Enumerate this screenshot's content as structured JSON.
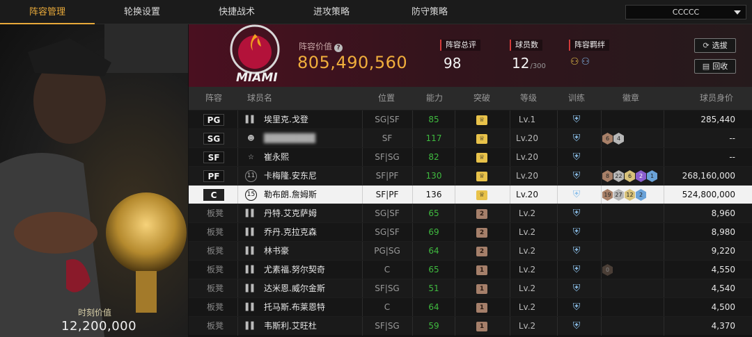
{
  "nav": {
    "tabs": [
      "阵容管理",
      "轮换设置",
      "快捷战术",
      "进攻策略",
      "防守策略"
    ],
    "active_index": 0,
    "team_select": "CCCCC"
  },
  "portrait": {
    "label": "时刻价值",
    "value": "12,200,000"
  },
  "summary": {
    "logo_text": "MIAMI",
    "value_label": "阵容价值",
    "value": "805,490,560",
    "overall_label": "阵容总评",
    "overall_value": "98",
    "count_label": "球员数",
    "count_value": "12",
    "count_max": "/300",
    "bond_label": "阵容羁绊",
    "select_button": "选拔",
    "recycle_button": "回收"
  },
  "table": {
    "headers": [
      "阵容",
      "球员名",
      "位置",
      "能力",
      "突破",
      "等级",
      "训练",
      "徽章",
      "球员身价"
    ],
    "rows": [
      {
        "slot": "PG",
        "starter": true,
        "icon": "bars",
        "name": "埃里克.戈登",
        "pos": "SG|SF",
        "ability": "85",
        "break": "crown",
        "level": "Lv.1",
        "badges": [],
        "salary": "285,440"
      },
      {
        "slot": "SG",
        "starter": true,
        "icon": "person",
        "name": "████████",
        "blur": true,
        "pos": "SF",
        "ability": "117",
        "break": "crown",
        "level": "Lv.20",
        "badges": [
          {
            "t": "6",
            "c": "bronze"
          },
          {
            "t": "4",
            "c": "silver"
          }
        ],
        "salary": "--"
      },
      {
        "slot": "SF",
        "starter": true,
        "icon": "star",
        "name": "崔永熙",
        "pos": "SF|SG",
        "ability": "82",
        "break": "crown",
        "level": "Lv.20",
        "badges": [],
        "salary": "--"
      },
      {
        "slot": "PF",
        "starter": true,
        "icon": "num",
        "icon_text": "11",
        "name": "卡梅隆.安东尼",
        "pos": "SF|PF",
        "ability": "130",
        "break": "crown",
        "level": "Lv.20",
        "badges": [
          {
            "t": "8",
            "c": "bronze"
          },
          {
            "t": "22",
            "c": "silver"
          },
          {
            "t": "6",
            "c": "gold"
          },
          {
            "t": "2",
            "c": "purple"
          },
          {
            "t": "1",
            "c": "blue"
          }
        ],
        "salary": "268,160,000"
      },
      {
        "slot": "C",
        "starter": true,
        "highlight": true,
        "icon": "num",
        "icon_text": "15",
        "name": "勒布朗.詹姆斯",
        "pos": "SF|PF",
        "ability": "136",
        "break": "crown",
        "level": "Lv.20",
        "badges": [
          {
            "t": "19",
            "c": "bronze"
          },
          {
            "t": "27",
            "c": "silver"
          },
          {
            "t": "12",
            "c": "gold"
          },
          {
            "t": "2",
            "c": "blue"
          }
        ],
        "salary": "524,800,000"
      },
      {
        "slot": "板凳",
        "starter": false,
        "icon": "bars",
        "name": "丹特.艾克萨姆",
        "pos": "SG|SF",
        "ability": "65",
        "break": "2",
        "level": "Lv.2",
        "badges": [],
        "salary": "8,960"
      },
      {
        "slot": "板凳",
        "starter": false,
        "icon": "bars",
        "name": "乔丹.克拉克森",
        "pos": "SG|SF",
        "ability": "69",
        "break": "2",
        "level": "Lv.2",
        "badges": [],
        "salary": "8,980"
      },
      {
        "slot": "板凳",
        "starter": false,
        "icon": "bars",
        "name": "林书豪",
        "pos": "PG|SG",
        "ability": "64",
        "break": "2",
        "level": "Lv.2",
        "badges": [],
        "salary": "9,220"
      },
      {
        "slot": "板凳",
        "starter": false,
        "icon": "bars",
        "name": "尤素福.努尔契奇",
        "pos": "C",
        "ability": "65",
        "break": "1",
        "level": "Lv.2",
        "badges": [
          {
            "t": "0",
            "c": "dark"
          }
        ],
        "salary": "4,550"
      },
      {
        "slot": "板凳",
        "starter": false,
        "icon": "bars",
        "name": "达米恩.威尔金斯",
        "pos": "SF|SG",
        "ability": "51",
        "break": "1",
        "level": "Lv.2",
        "badges": [],
        "salary": "4,540"
      },
      {
        "slot": "板凳",
        "starter": false,
        "icon": "bars",
        "name": "托马斯.布莱恩特",
        "pos": "C",
        "ability": "64",
        "break": "1",
        "level": "Lv.2",
        "badges": [],
        "salary": "4,500"
      },
      {
        "slot": "板凳",
        "starter": false,
        "icon": "bars",
        "name": "韦斯利.艾旺杜",
        "pos": "SF|SG",
        "ability": "59",
        "break": "1",
        "level": "Lv.2",
        "badges": [],
        "salary": "4,370"
      }
    ]
  },
  "colors": {
    "accent": "#e8a93a",
    "summary_bg": "#4a1020",
    "ability_green": "#3fba3f",
    "highlight_row": "#f2f2f2"
  }
}
